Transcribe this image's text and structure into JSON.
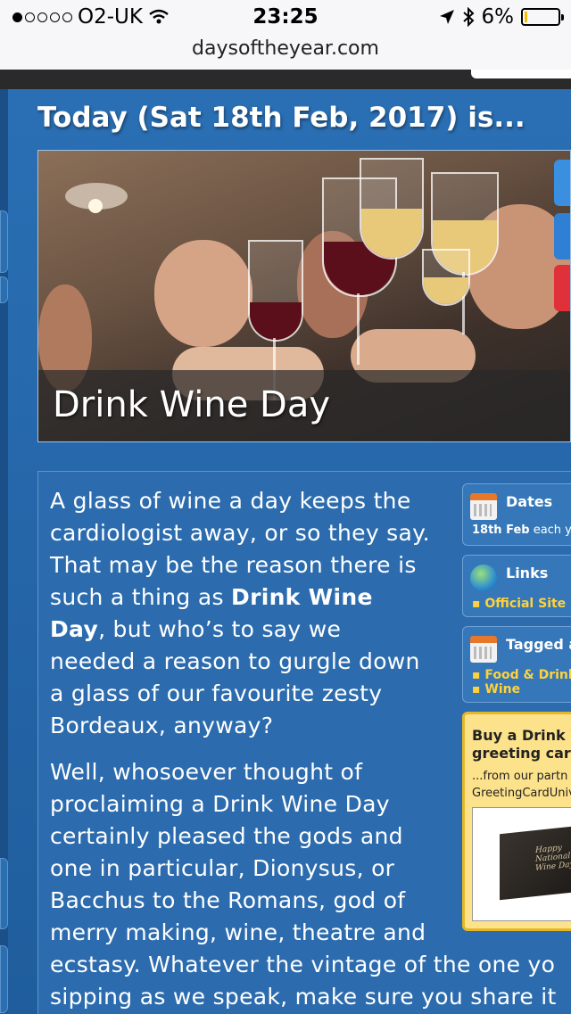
{
  "status_bar": {
    "carrier": "O2-UK",
    "time": "23:25",
    "battery": "6%",
    "battery_level": 0.06,
    "signal_bars": 1
  },
  "url_bar": {
    "domain": "daysoftheyear.com"
  },
  "headline": "Today (Sat 18th Feb, 2017) is...",
  "hero": {
    "title": "Drink Wine Day"
  },
  "article": {
    "p1_lines": [
      "A glass of wine a day keeps the",
      "cardiologist away, or so they say.",
      "That may be the reason there is",
      "such a thing as ",
      "Drink Wine",
      "Day",
      ", but who’s to say we",
      "needed a reason to gurgle down",
      "a glass of our favourite zesty",
      "Bordeaux, anyway?"
    ],
    "p2_lines": [
      "Well, whosoever thought of",
      "proclaiming a Drink Wine Day",
      "certainly pleased the gods and",
      "one in particular, Dionysus, or",
      "Bacchus to the Romans, god of",
      "merry making, wine, theatre and",
      "ecstasy. Whatever the vintage of the one yo",
      "sipping as we speak, make sure you share it"
    ]
  },
  "sidebar": {
    "dates": {
      "title": "Dates",
      "date": "18th Feb",
      "suffix": " each yea"
    },
    "links": {
      "title": "Links",
      "items": [
        "Official Site"
      ]
    },
    "tagged": {
      "title": "Tagged a",
      "items": [
        "Food & Drink",
        "Wine"
      ]
    },
    "buy": {
      "title_line1": "Buy a Drink W",
      "title_line2": "greeting card",
      "sub_line1": "...from our partn",
      "sub_line2": "GreetingCardUniv",
      "card_text": "Happy National Wine Day"
    }
  },
  "colors": {
    "page_bg": "#2a6fb4",
    "link_yellow": "#ffd23c",
    "buy_bg": "#fce28a"
  }
}
